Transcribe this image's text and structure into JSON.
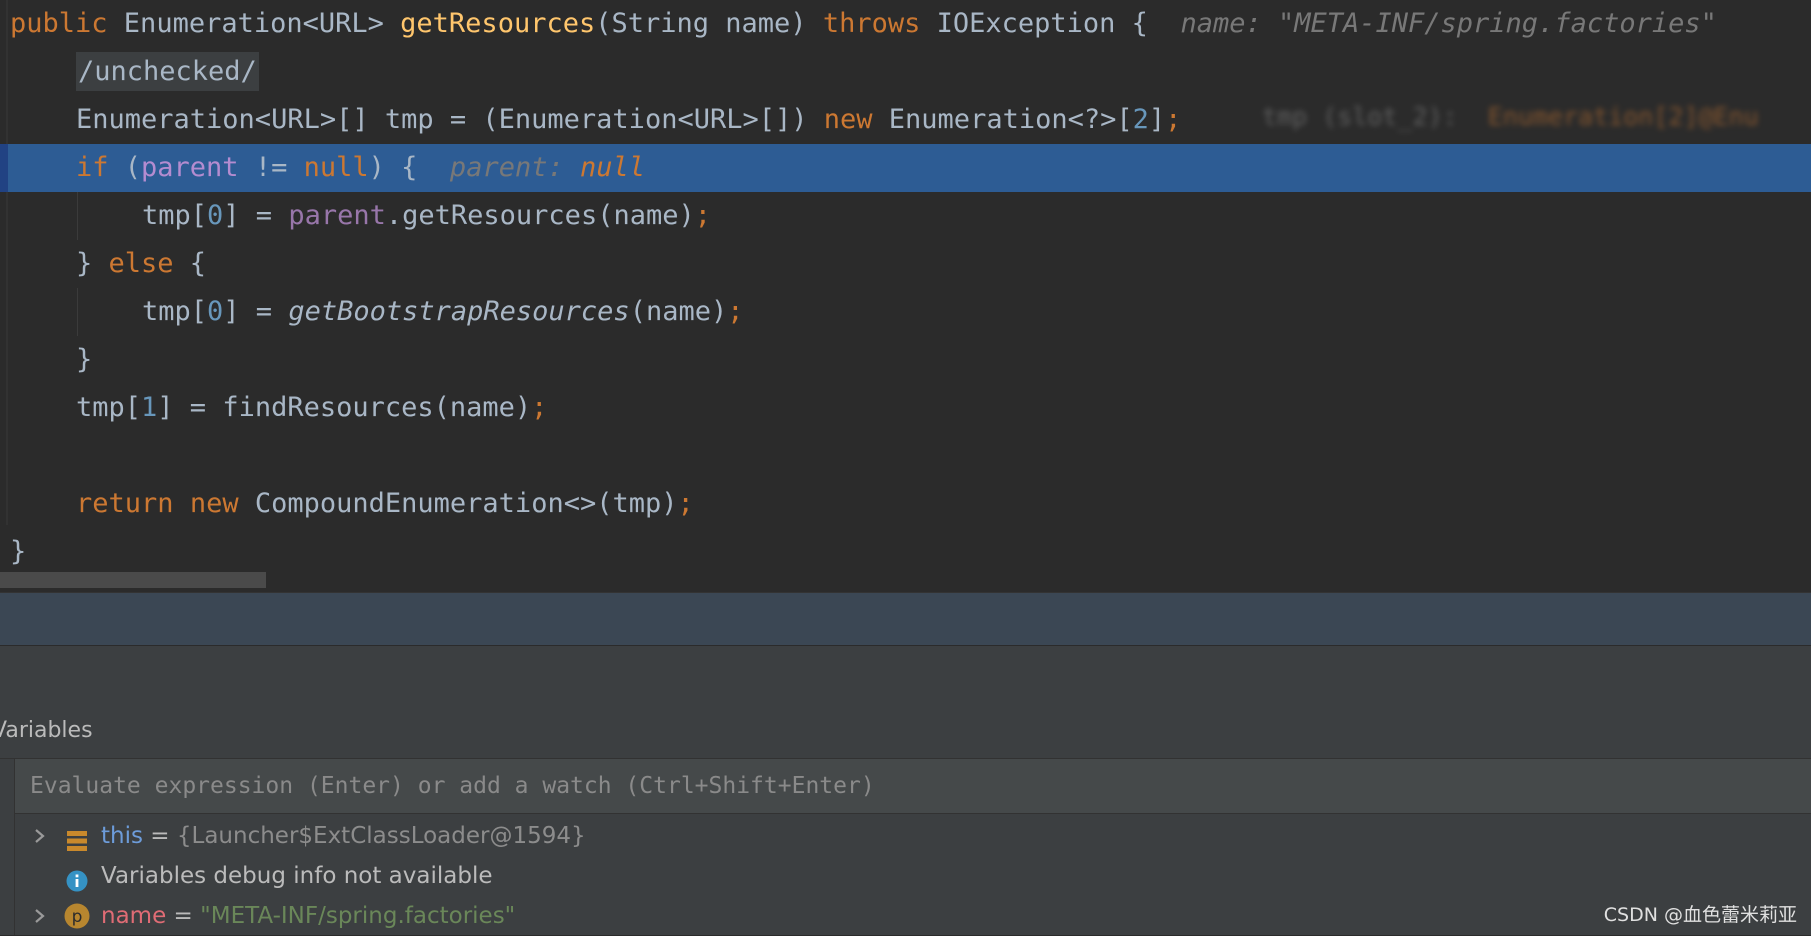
{
  "editor": {
    "lines": [
      {
        "parts": [
          [
            "kw",
            "public"
          ],
          [
            "",
            " Enumeration<URL> "
          ],
          [
            "fn",
            "getResources"
          ],
          [
            "",
            "(String name) "
          ],
          [
            "kw",
            "throws"
          ],
          [
            "",
            " IOException {"
          ]
        ],
        "hint": "name: \"META-INF/spring.factories\""
      },
      {
        "indent": 1,
        "unchecked": "/unchecked/"
      },
      {
        "indent": 1,
        "parts": [
          [
            "",
            "Enumeration<URL>[] tmp = (Enumeration<URL>[]) "
          ],
          [
            "kw",
            "new"
          ],
          [
            "",
            " Enumeration<?>["
          ],
          [
            "num",
            "2"
          ],
          [
            "",
            "]"
          ],
          [
            "semi",
            ";"
          ]
        ]
      },
      {
        "indent": 1,
        "highlight": true,
        "parts": [
          [
            "kw",
            "if"
          ],
          [
            "",
            " ("
          ],
          [
            "fld",
            "parent"
          ],
          [
            "",
            " != "
          ],
          [
            "kw",
            "null"
          ],
          [
            "",
            ") {"
          ]
        ],
        "hint_label": "parent:",
        "hint_value": "null"
      },
      {
        "indent": 2,
        "parts": [
          [
            "",
            "tmp["
          ],
          [
            "num",
            "0"
          ],
          [
            "",
            "] = "
          ],
          [
            "fld",
            "parent"
          ],
          [
            "",
            ".getResources(name)"
          ],
          [
            "semi",
            ";"
          ]
        ]
      },
      {
        "indent": 1,
        "parts": [
          [
            "",
            "} "
          ],
          [
            "kw",
            "else"
          ],
          [
            "",
            " {"
          ]
        ]
      },
      {
        "indent": 2,
        "parts": [
          [
            "",
            "tmp["
          ],
          [
            "num",
            "0"
          ],
          [
            "",
            "] = "
          ],
          [
            "it",
            "getBootstrapResources"
          ],
          [
            "",
            "(name)"
          ],
          [
            "semi",
            ";"
          ]
        ]
      },
      {
        "indent": 1,
        "parts": [
          [
            "",
            "}"
          ]
        ]
      },
      {
        "indent": 1,
        "parts": [
          [
            "",
            "tmp["
          ],
          [
            "num",
            "1"
          ],
          [
            "",
            "] = findResources(name)"
          ],
          [
            "semi",
            ";"
          ]
        ]
      },
      {
        "indent": 0,
        "parts": []
      },
      {
        "indent": 1,
        "parts": [
          [
            "kw",
            "return"
          ],
          [
            "",
            " "
          ],
          [
            "kw",
            "new"
          ],
          [
            "",
            " CompoundEnumeration<>(tmp)"
          ],
          [
            "semi",
            ";"
          ]
        ]
      },
      {
        "indent": 0,
        "parts": [
          [
            "",
            "}"
          ]
        ]
      }
    ],
    "blurred_hint_label": "tmp (slot_2):",
    "blurred_hint_value": "Enumeration[2]@Enu"
  },
  "variables": {
    "title": "Variables",
    "eval_placeholder": "Evaluate expression (Enter) or add a watch (Ctrl+Shift+Enter)",
    "rows": [
      {
        "name": "this",
        "eq": " = ",
        "value": "{Launcher$ExtClassLoader@1594}",
        "icon": "stack-frame-icon",
        "expandable": true
      },
      {
        "message": "Variables debug info not available",
        "icon": "info-icon",
        "expandable": false
      },
      {
        "name": "name",
        "eq": " = ",
        "value": "\"META-INF/spring.factories\"",
        "icon": "parameter-icon",
        "icon_letter": "p",
        "expandable": true
      }
    ]
  },
  "watermark": "CSDN @血色蕾米莉亚",
  "colors": {
    "keyword": "#cc7832",
    "method": "#ffc66d",
    "field": "#9876aa",
    "number": "#6897bb",
    "selection": "#2d5c94",
    "string": "#6a8759"
  }
}
